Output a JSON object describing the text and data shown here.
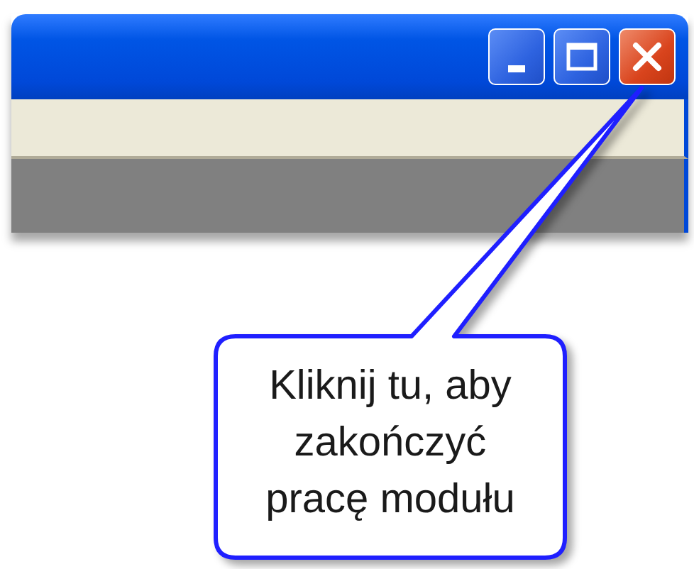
{
  "title_bar": {
    "buttons": [
      {
        "kind": "minimize"
      },
      {
        "kind": "maximize"
      },
      {
        "kind": "close"
      }
    ]
  },
  "callout": {
    "text": "Kliknij tu, aby\nzakończyć\npracę modułu"
  }
}
